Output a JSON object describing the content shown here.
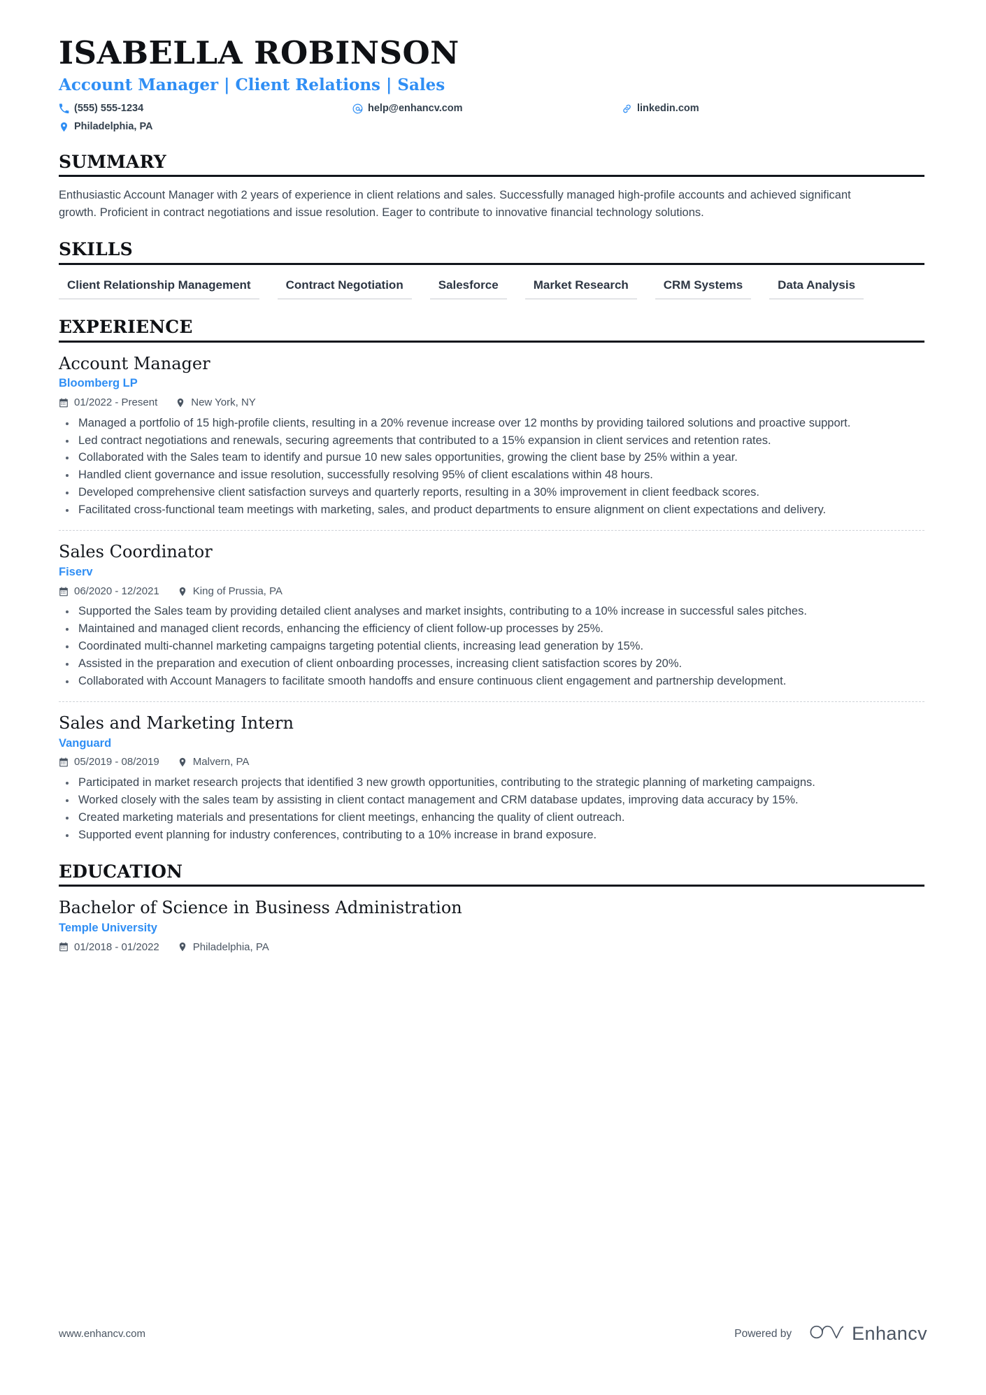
{
  "header": {
    "name": "ISABELLA ROBINSON",
    "headline": "Account Manager | Client Relations | Sales",
    "accent_color": "#2f8ef4",
    "contacts": [
      {
        "icon": "phone-icon",
        "text": "(555) 555-1234"
      },
      {
        "icon": "email-icon",
        "text": "help@enhancv.com"
      },
      {
        "icon": "link-icon",
        "text": "linkedin.com"
      },
      {
        "icon": "location-pin-icon",
        "text": "Philadelphia, PA"
      }
    ]
  },
  "sections": {
    "summary": {
      "title": "SUMMARY",
      "text": "Enthusiastic Account Manager with 2 years of experience in client relations and sales. Successfully managed high-profile accounts and achieved significant growth. Proficient in contract negotiations and issue resolution. Eager to contribute to innovative financial technology solutions."
    },
    "skills": {
      "title": "SKILLS",
      "items": [
        "Client Relationship Management",
        "Contract Negotiation",
        "Salesforce",
        "Market Research",
        "CRM Systems",
        "Data Analysis"
      ]
    },
    "experience": {
      "title": "EXPERIENCE",
      "entries": [
        {
          "title": "Account Manager",
          "org": "Bloomberg LP",
          "dates": "01/2022 - Present",
          "location": "New York, NY",
          "bullets": [
            "Managed a portfolio of 15 high-profile clients, resulting in a 20% revenue increase over 12 months by providing tailored solutions and proactive support.",
            "Led contract negotiations and renewals, securing agreements that contributed to a 15% expansion in client services and retention rates.",
            "Collaborated with the Sales team to identify and pursue 10 new sales opportunities, growing the client base by 25% within a year.",
            "Handled client governance and issue resolution, successfully resolving 95% of client escalations within 48 hours.",
            "Developed comprehensive client satisfaction surveys and quarterly reports, resulting in a 30% improvement in client feedback scores.",
            "Facilitated cross-functional team meetings with marketing, sales, and product departments to ensure alignment on client expectations and delivery."
          ]
        },
        {
          "title": "Sales Coordinator",
          "org": "Fiserv",
          "dates": "06/2020 - 12/2021",
          "location": "King of Prussia, PA",
          "bullets": [
            "Supported the Sales team by providing detailed client analyses and market insights, contributing to a 10% increase in successful sales pitches.",
            "Maintained and managed client records, enhancing the efficiency of client follow-up processes by 25%.",
            "Coordinated multi-channel marketing campaigns targeting potential clients, increasing lead generation by 15%.",
            "Assisted in the preparation and execution of client onboarding processes, increasing client satisfaction scores by 20%.",
            "Collaborated with Account Managers to facilitate smooth handoffs and ensure continuous client engagement and partnership development."
          ]
        },
        {
          "title": "Sales and Marketing Intern",
          "org": "Vanguard",
          "dates": "05/2019 - 08/2019",
          "location": "Malvern, PA",
          "bullets": [
            "Participated in market research projects that identified 3 new growth opportunities, contributing to the strategic planning of marketing campaigns.",
            "Worked closely with the sales team by assisting in client contact management and CRM database updates, improving data accuracy by 15%.",
            "Created marketing materials and presentations for client meetings, enhancing the quality of client outreach.",
            "Supported event planning for industry conferences, contributing to a 10% increase in brand exposure."
          ]
        }
      ]
    },
    "education": {
      "title": "EDUCATION",
      "entries": [
        {
          "title": "Bachelor of Science in Business Administration",
          "org": "Temple University",
          "dates": "01/2018 - 01/2022",
          "location": "Philadelphia, PA"
        }
      ]
    }
  },
  "footer": {
    "url": "www.enhancv.com",
    "powered_by": "Powered by",
    "brand": "Enhancv"
  }
}
